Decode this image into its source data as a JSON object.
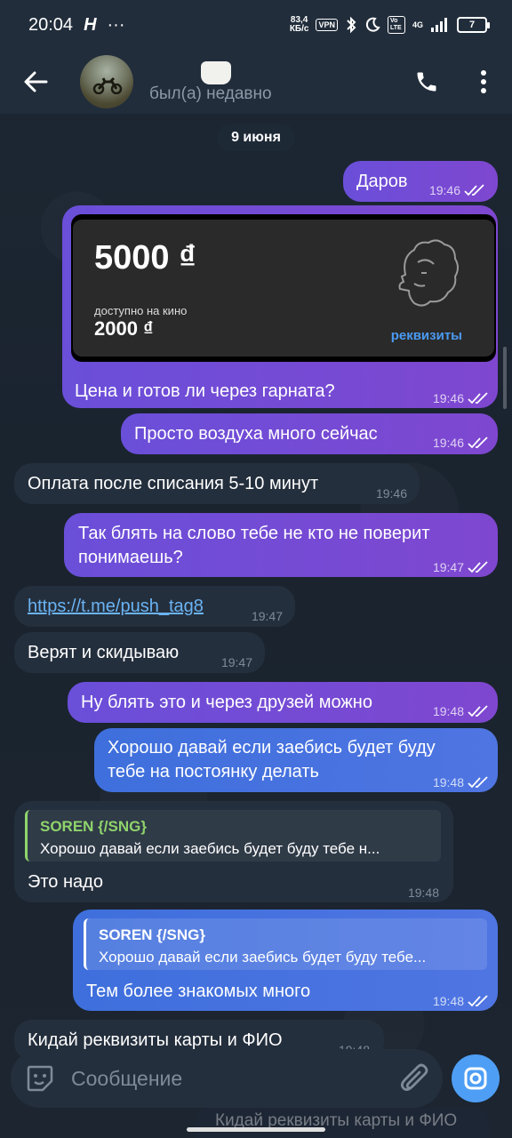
{
  "status_bar": {
    "time": "20:04",
    "speed_value": "83,4",
    "speed_unit": "КБ/с",
    "vpn": "VPN",
    "volte": "Vo LTE",
    "network": "4G",
    "battery": "7"
  },
  "header": {
    "status": "был(а) недавно"
  },
  "date_chip": "9 июня",
  "messages": [
    {
      "text": "Даров",
      "time": "19:46"
    },
    {
      "card": {
        "amount": "5000",
        "caption": "доступно на кино",
        "sub_amount": "2000",
        "currency_symbol": "₫",
        "link": "реквизиты"
      },
      "text": "Цена и готов ли через гарната?",
      "time": "19:46"
    },
    {
      "text": "Просто воздуха много сейчас",
      "time": "19:46"
    },
    {
      "text": "Оплата после списания 5-10 минут",
      "time": "19:46"
    },
    {
      "line1": "Так блять на слово тебе не кто не поверит",
      "line2": "понимаешь?",
      "time": "19:47"
    },
    {
      "text": "https://t.me/push_tag8",
      "time": "19:47"
    },
    {
      "text": "Верят и скидываю",
      "time": "19:47"
    },
    {
      "text": "Ну блять это и через друзей можно",
      "time": "19:48"
    },
    {
      "line1": "Хорошо давай если заебись будет буду",
      "line2": "тебе на постоянку делать",
      "time": "19:48"
    },
    {
      "quote_name": "SOREN {/SNG}",
      "quote_text": "Хорошо давай если заебись будет буду тебе н...",
      "text": "Это надо",
      "time": "19:48"
    },
    {
      "quote_name": "SOREN {/SNG}",
      "quote_text": "Хорошо давай если заебись будет буду тебе...",
      "text": "Тем более знакомых много",
      "time": "19:48"
    },
    {
      "text": "Кидай реквизиты карты и ФИО",
      "time": "19:48"
    }
  ],
  "input": {
    "placeholder": "Сообщение"
  },
  "pinned_preview": "Кидай реквизиты карты и ФИО",
  "colors": {
    "bg": "#17212b",
    "header": "#212d3b",
    "out_purple": "#7048d5",
    "out_blue": "#4471de",
    "incoming": "#242f3d",
    "link": "#4b9af2",
    "quote_green": "#8fd46b",
    "quote_white": "#ffffff"
  }
}
